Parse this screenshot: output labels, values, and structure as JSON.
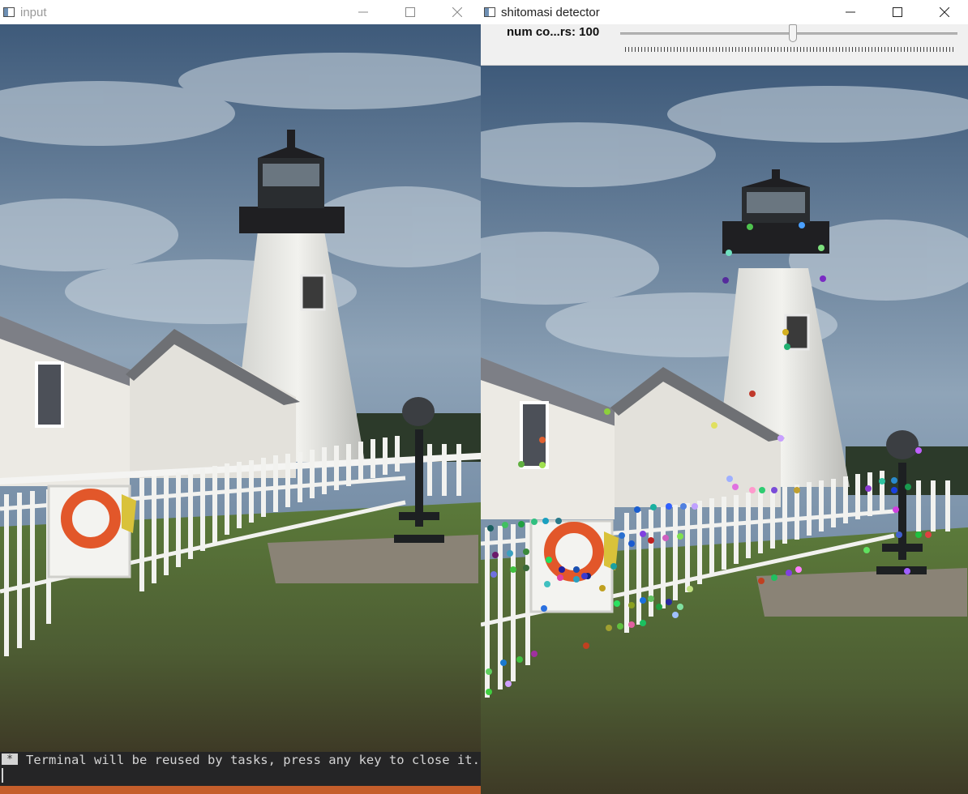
{
  "windows": {
    "input": {
      "title": "input",
      "controls": [
        "minimize",
        "maximize",
        "close"
      ]
    },
    "detector": {
      "title": "shitomasi detector",
      "controls": [
        "minimize",
        "maximize",
        "close"
      ],
      "trackbar": {
        "label": "num co...rs: 100",
        "value_fraction": 0.5
      }
    }
  },
  "terminal": {
    "marker": "*",
    "message": "Terminal will be reused by tasks, press any key to close it."
  },
  "icons": [
    "app-window-icon",
    "minimize-icon",
    "maximize-icon",
    "close-icon"
  ],
  "colors": {
    "status_bar": "#c55e2b",
    "terminal_bg": "#252526",
    "panel_bg": "#f0f0f0"
  }
}
